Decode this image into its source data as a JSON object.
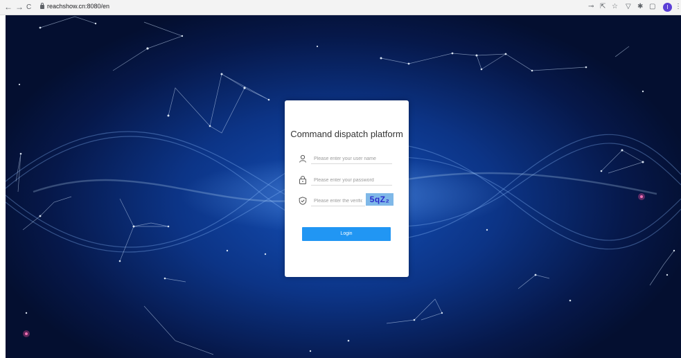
{
  "browser": {
    "url": "reachshow.cn:8080/en",
    "nav": {
      "back": "←",
      "forward": "→",
      "reload": "C"
    },
    "toolbar_icons": [
      "key-icon",
      "share-icon",
      "star-icon",
      "filter-icon",
      "extensions-icon",
      "sidebar-icon"
    ],
    "profile_initial": "I",
    "menu": "⋮"
  },
  "login": {
    "title": "Command dispatch platform",
    "username_placeholder": "Please enter your user name",
    "password_placeholder": "Please enter your password",
    "verification_placeholder": "Please enter the verification code",
    "captcha_text": "5qZ₂",
    "login_label": "Login"
  },
  "colors": {
    "primary_button": "#2196f3",
    "background_dark": "#06184a",
    "background_glow": "#1450b8",
    "captcha_bg": "#7fb8e8"
  }
}
